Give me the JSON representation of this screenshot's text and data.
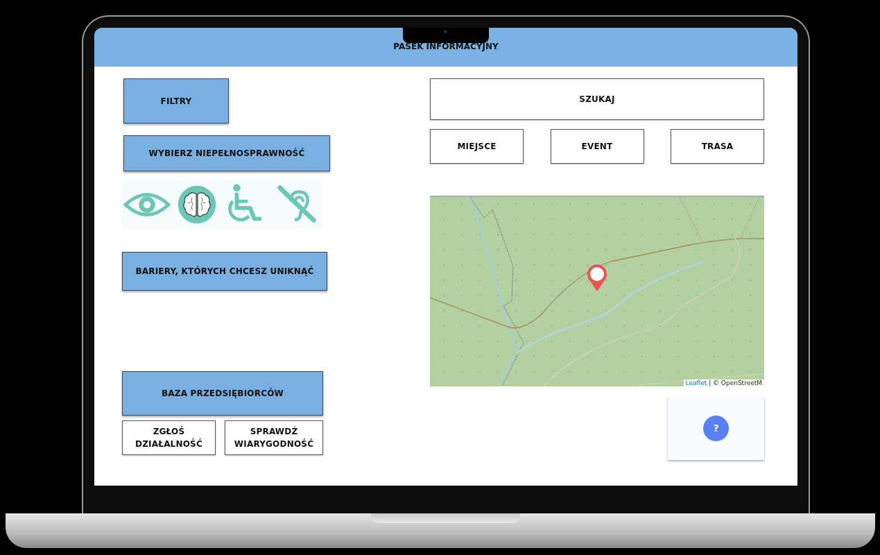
{
  "header": {
    "title": "PASEK INFORMACYJNY"
  },
  "left_panel": {
    "filters_button": "FILTRY",
    "disability_button": "WYBIERZ NIEPEŁNOSPRAWNOŚĆ",
    "disability_icons": [
      {
        "kind": "eye"
      },
      {
        "kind": "brain"
      },
      {
        "kind": "wheelchair"
      },
      {
        "kind": "hearing"
      }
    ],
    "barriers_button": "BARIERY, KTÓRYCH CHCESZ UNIKNĄĆ",
    "business_button": "BAZA PRZEDSIĘBIORCÓW",
    "business_actions": [
      "ZGŁOŚ DZIAŁALNOŚĆ",
      "SPRAWDŹ WIARYGODNOŚĆ"
    ]
  },
  "right_panel": {
    "search_button": "SZUKAJ",
    "categories": [
      "MIEJSCE",
      "EVENT",
      "TRASA"
    ],
    "map": {
      "attribution_link": "Leaflet",
      "attribution_text": "| © OpenStreetM"
    },
    "help_button": "?"
  }
}
